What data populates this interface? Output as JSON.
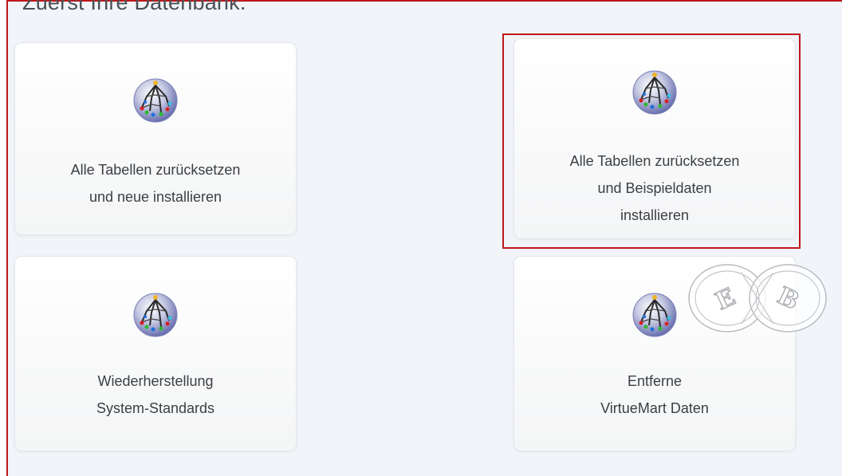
{
  "heading": "Zuerst Ihre Datenbank.",
  "cards": [
    {
      "name": "reset-tables-install-new",
      "lines": [
        "Alle Tabellen zurücksetzen",
        "und neue installieren"
      ],
      "icon": "database-tree-icon"
    },
    {
      "name": "reset-tables-install-sample-data",
      "lines": [
        "Alle Tabellen zurücksetzen",
        "und Beispieldaten",
        "installieren"
      ],
      "icon": "database-tree-icon",
      "highlighted": true
    },
    {
      "name": "restore-system-defaults",
      "lines": [
        "Wiederherstellung",
        "System-Standards"
      ],
      "icon": "database-tree-icon"
    },
    {
      "name": "remove-virtuemart-data",
      "lines": [
        "Entferne",
        "VirtueMart Daten"
      ],
      "icon": "database-tree-icon"
    }
  ],
  "colors": {
    "highlight": "#c0161b",
    "background": "#f1f4f8",
    "text": "#3b3f43"
  },
  "watermark_text": "EXB"
}
